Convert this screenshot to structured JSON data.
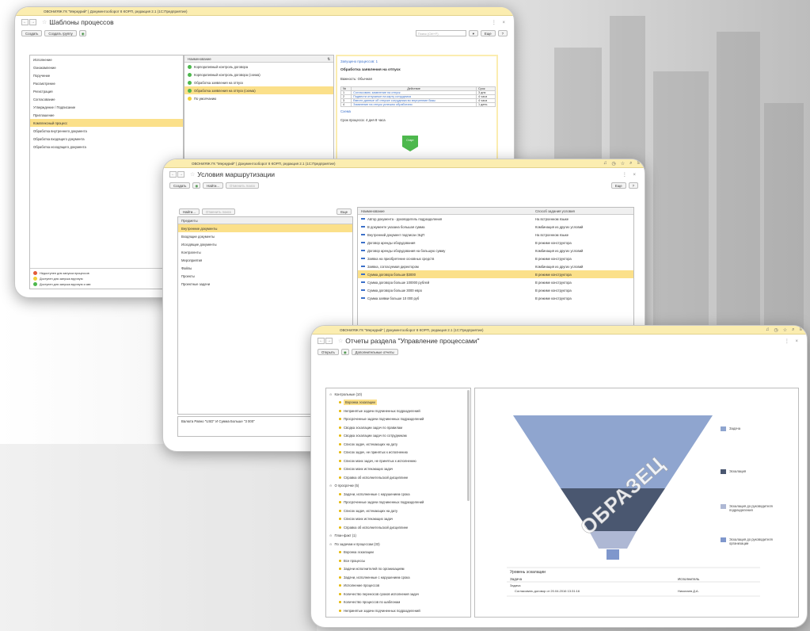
{
  "background": {
    "accent": "#fbedb0",
    "selection": "#fbe08a"
  },
  "win1": {
    "title_bar": "ОВОНИЯЖ ГК \"Меркурий\" | Документооборот 8 КОРП, редакция 2.1 (1С:Предприятие)",
    "title": "Шаблоны процессов",
    "toolbar": {
      "create": "Создать",
      "create_group": "Создать группу",
      "search_placeholder": "Поиск (Ctrl+F)",
      "more": "Еще",
      "help": "?"
    },
    "left_items": [
      "Исполнение",
      "Ознакомление",
      "Поручение",
      "Рассмотрение",
      "Регистрация",
      "Согласование",
      "Утверждение / Подписание",
      "Приглашение",
      "Комплексный процесс",
      "Обработка внутреннего документа",
      "Обработка входящего документа",
      "Обработка исходящего документа"
    ],
    "left_selected": 8,
    "legend": [
      {
        "text": "Недоступен для запуска процессов",
        "color": "#e25b3a"
      },
      {
        "text": "Доступен для запуска вручную",
        "color": "#f2d13b"
      },
      {
        "text": "Доступен для запуска вручную и авт.",
        "color": "#4db84d"
      }
    ],
    "mid_header": "Наименование",
    "mid_items": [
      {
        "text": "Корпоративный контроль договора",
        "color": "#4db84d"
      },
      {
        "text": "Корпоративный контроль договора (схема)",
        "color": "#4db84d"
      },
      {
        "text": "Обработка заявления на отпуск",
        "color": "#4db84d"
      },
      {
        "text": "Обработка заявления на отпуск (схема)",
        "color": "#4db84d"
      },
      {
        "text": "По умолчанию",
        "color": "#f2d13b"
      }
    ],
    "mid_selected": 3,
    "right": {
      "launched": "Запущено процессов: 1",
      "heading": "Обработка заявления на отпуск",
      "importance": "Важность: Обычная",
      "table_headers": [
        "№",
        "Действие",
        "Срок"
      ],
      "table_rows": [
        [
          "1",
          "Согласовать заявление на отпуск",
          "3 дня"
        ],
        [
          "2",
          "Подвести отпускные на карту сотрудника",
          "4 часа"
        ],
        [
          "3",
          "Ввести данные об отпуске сотрудника во внутренние базы",
          "4 часа"
        ],
        [
          "4",
          "Заявление на отпуск успешно обработано",
          "1 день"
        ]
      ],
      "link": "Схема",
      "duration": "Срок процесса: 4 дня 8 часа",
      "start_label": "Старт"
    }
  },
  "win2": {
    "title_bar": "ОВОНИЯЖ ГК \"Меркурий\" | Документооборот 8 КОРП, редакция 2.1 (1С:Предприятие)",
    "title": "Условия маршрутизации",
    "toolbar": {
      "create": "Создать",
      "find": "Найти...",
      "cancel_search": "Отменить поиск",
      "more": "Еще",
      "help": "?"
    },
    "left_toolbar": {
      "find": "Найти...",
      "cancel": "Отменить поиск",
      "more": "Еще"
    },
    "left_header": "Предметы",
    "left_items": [
      "Внутренние документы",
      "Входящие документы",
      "Исходящие документы",
      "Контрагенты",
      "Мероприятия",
      "Файлы",
      "Проекты",
      "Проектные задачи"
    ],
    "left_selected": 0,
    "footer": "Валюта Равно \"USD\" И Сумма Больше \"3 000\"",
    "headers": [
      "Наименование",
      "Способ задания условия"
    ],
    "rows": [
      [
        "Автор документа - руководитель подразделения",
        "На встроенном языке"
      ],
      [
        "В документе указана большая сумма",
        "Комбинация из других условий"
      ],
      [
        "Внутренний документ подписан ЭЦП",
        "На встроенном языке"
      ],
      [
        "Договор аренды оборудования",
        "В режиме конструктора"
      ],
      [
        "Договор аренды оборудования на большую сумму",
        "Комбинация из других условий"
      ],
      [
        "Заявка на приобретение основных средств",
        "В режиме конструктора"
      ],
      [
        "Заявка, согласуемая директором",
        "Комбинация из других условий"
      ],
      [
        "Сумма договора больше $3000",
        "В режиме конструктора"
      ],
      [
        "Сумма договора больше 100000 рублей",
        "В режиме конструктора"
      ],
      [
        "Сумма договора больше 3000 евро",
        "В режиме конструктора"
      ],
      [
        "Сумма заявки больше 10 000 руб",
        "В режиме конструктора"
      ]
    ],
    "selected_row": 7
  },
  "win3": {
    "title_bar": "ОВОНИЯЖ ГК \"Меркурий\" | Документооборот 8 КОРП, редакция 2.1 (1С:Предприятие)",
    "title": "Отчеты раздела \"Управление процессами\"",
    "toolbar": {
      "open": "Открыть",
      "additional": "Дополнительные отчеты"
    },
    "tree": [
      {
        "type": "group",
        "text": "Контрольные (10)"
      },
      {
        "type": "item",
        "text": "Воронка эскалации",
        "selected": true
      },
      {
        "type": "item",
        "text": "Непринятые задачи подчиненных подразделений"
      },
      {
        "type": "item",
        "text": "Просроченные задачи подчиненных подразделений"
      },
      {
        "type": "item",
        "text": "Сводка эскалации задач по правилам"
      },
      {
        "type": "item",
        "text": "Сводка эскалации задач по сотрудникам"
      },
      {
        "type": "item",
        "text": "Список задач, истекающих на дату"
      },
      {
        "type": "item",
        "text": "Список задач, не принятых к исполнению"
      },
      {
        "type": "item",
        "text": "Список моих задач, не принятых к исполнению"
      },
      {
        "type": "item",
        "text": "Список моих истекающих задач"
      },
      {
        "type": "item",
        "text": "Справка об исполнительской дисциплине"
      },
      {
        "type": "group",
        "text": "О просрочке (5)"
      },
      {
        "type": "item",
        "text": "Задачи, исполненные с нарушением срока"
      },
      {
        "type": "item",
        "text": "Просроченные задачи подчиненных подразделений"
      },
      {
        "type": "item",
        "text": "Список задач, истекающих на дату"
      },
      {
        "type": "item",
        "text": "Список моих истекающих задач"
      },
      {
        "type": "item",
        "text": "Справка об исполнительской дисциплине"
      },
      {
        "type": "group",
        "text": "План-факт (1)"
      },
      {
        "type": "group",
        "text": "По задачам и процессам (33)"
      },
      {
        "type": "item",
        "text": "Воронка эскалации"
      },
      {
        "type": "item",
        "text": "Все процессы"
      },
      {
        "type": "item",
        "text": "Задачи исполнителей по организациям"
      },
      {
        "type": "item",
        "text": "Задачи, исполненные с нарушением срока"
      },
      {
        "type": "item",
        "text": "Исполнение процессов"
      },
      {
        "type": "item",
        "text": "Количество переносов сроков исполнения задач"
      },
      {
        "type": "item",
        "text": "Количество процессов по шаблонам"
      },
      {
        "type": "item",
        "text": "Непринятые задачи подчиненных подразделений"
      }
    ],
    "chart": {
      "watermark": "ОБРАЗЕЦ",
      "legend": [
        {
          "text": "Задача",
          "color": "#8fa5cf"
        },
        {
          "text": "Эскалация",
          "color": "#4a5770"
        },
        {
          "text": "Эскалация до руководителя подразделения",
          "color": "#aeb8d4"
        },
        {
          "text": "Эскалация до руководителя организации",
          "color": "#7f97cc"
        }
      ],
      "table_title": "Уровень эскалации",
      "col_task": "Задача",
      "col_exec": "Исполнитель",
      "sub_task": "Задача",
      "row_task": "Согласовать договор от 20.04.2016 13:31:16",
      "row_exec": "Николаев Д.А."
    }
  }
}
